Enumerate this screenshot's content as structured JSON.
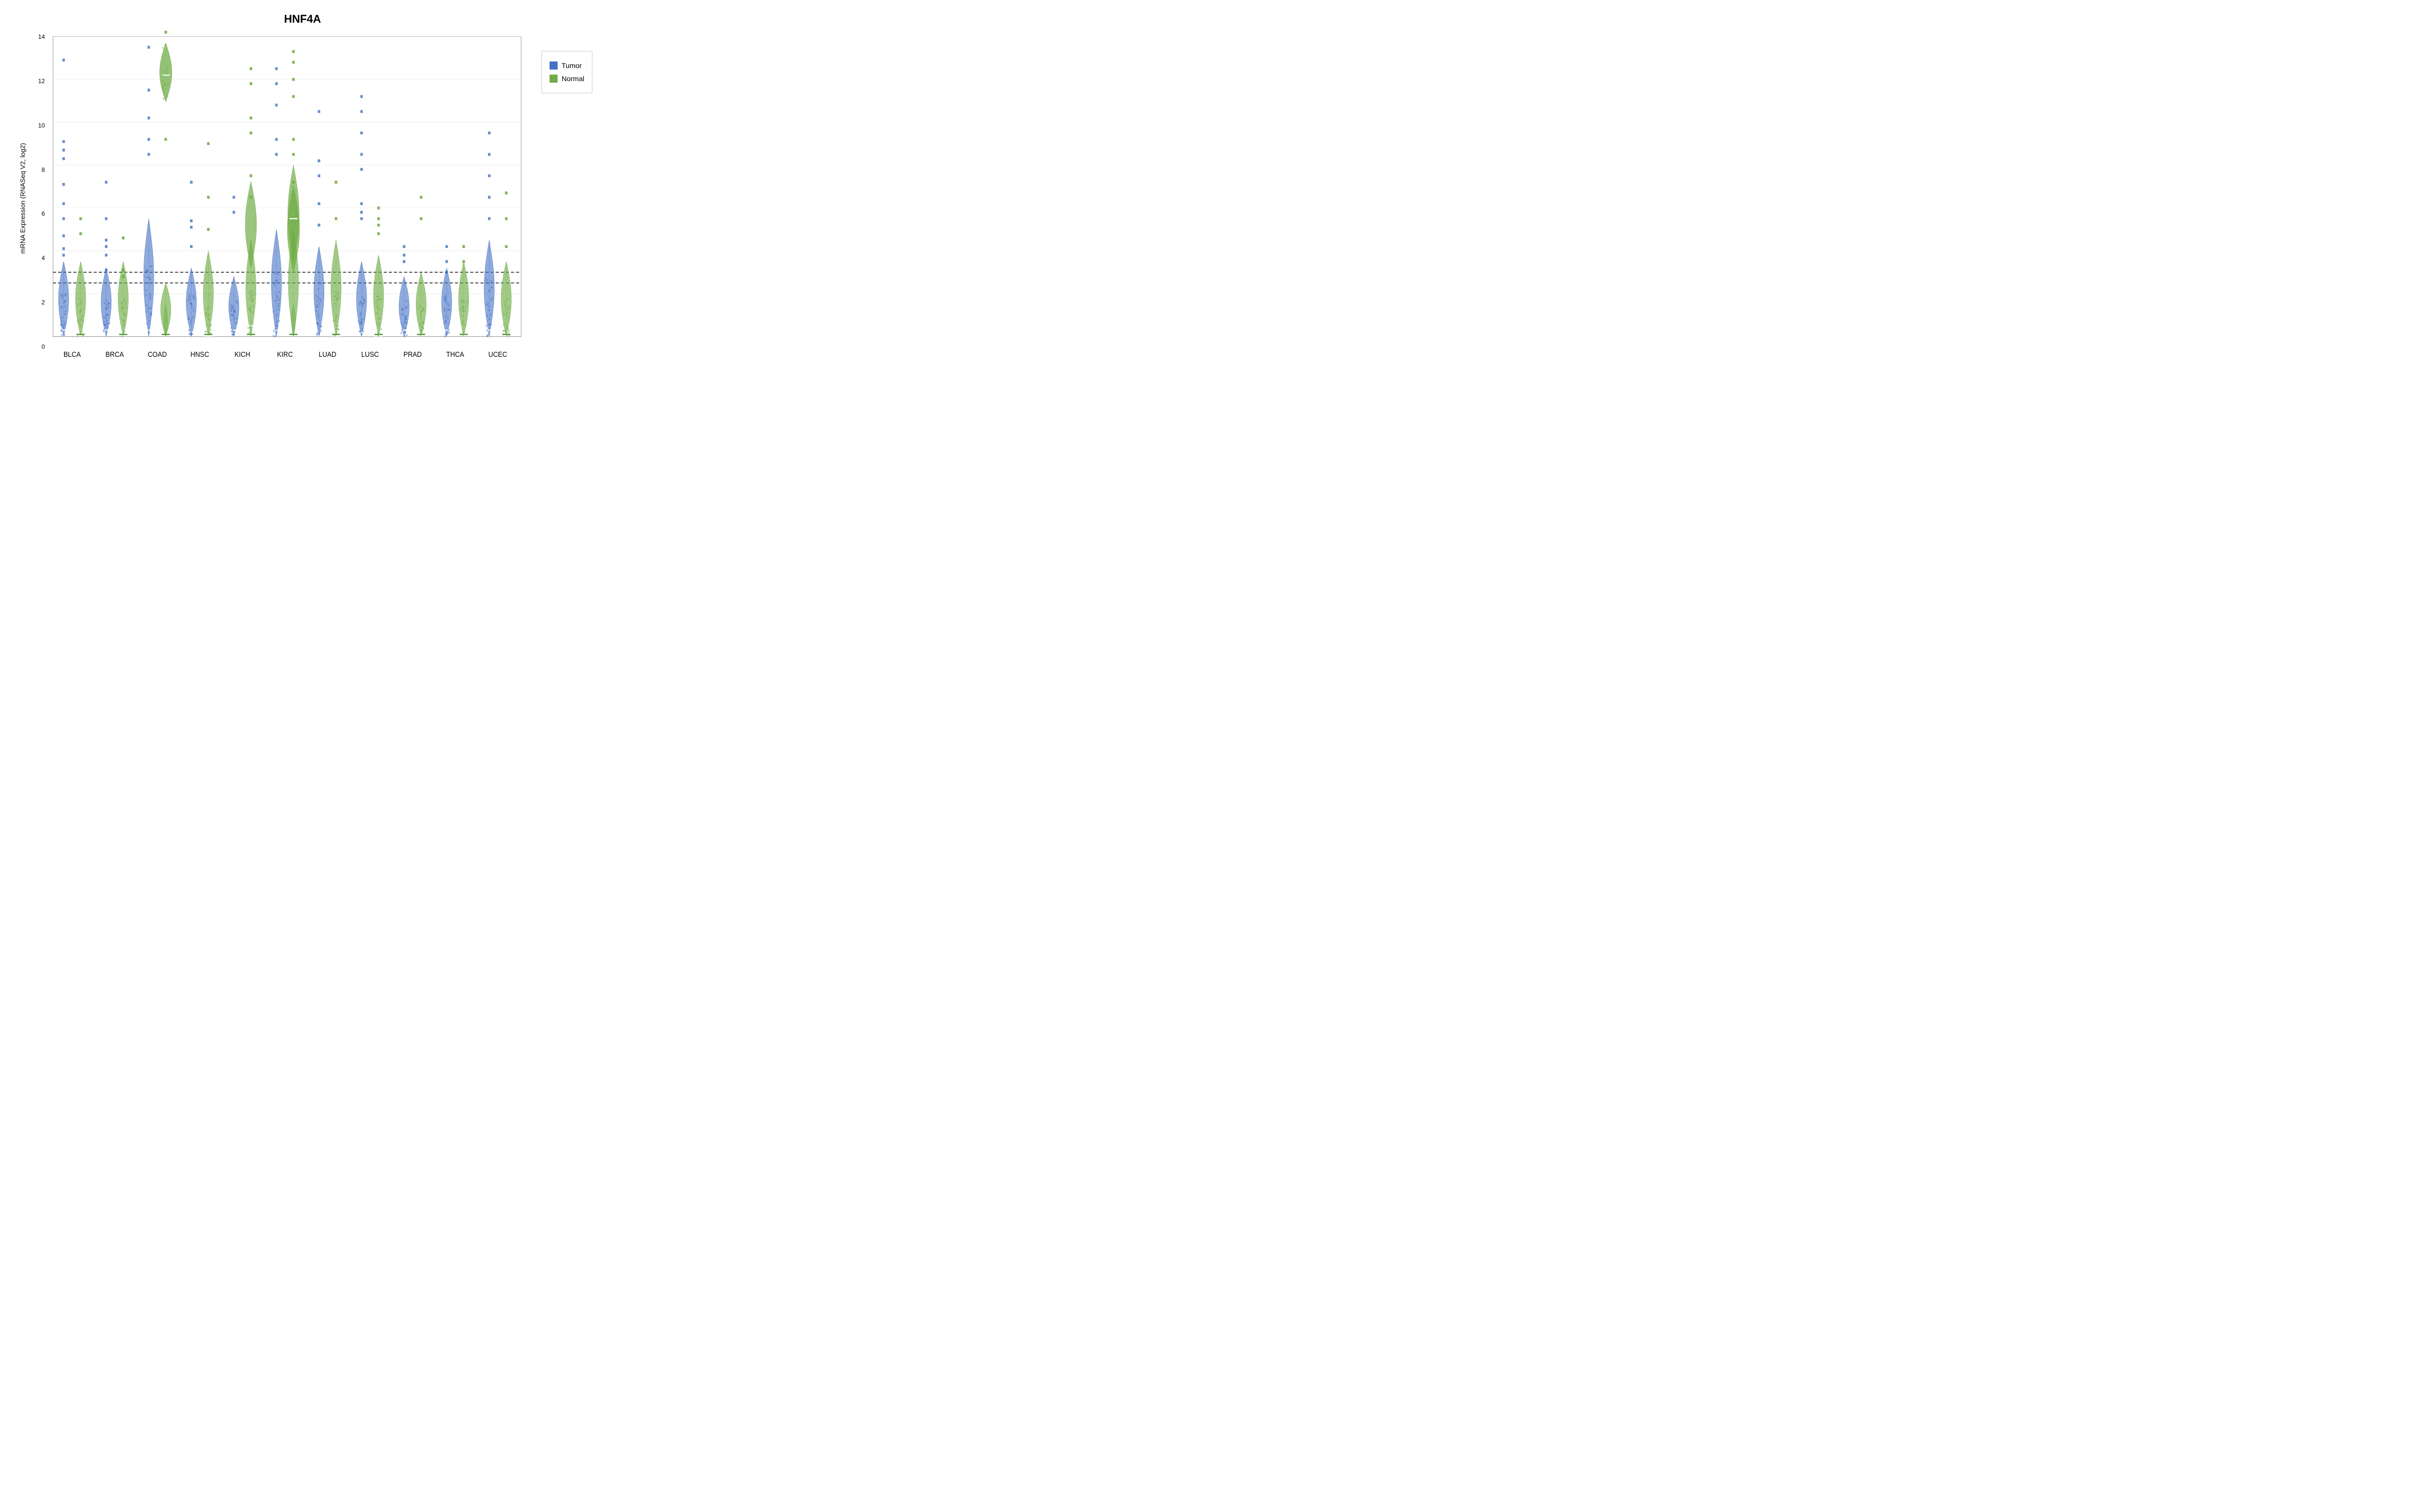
{
  "title": "HNF4A",
  "yAxisLabel": "mRNA Expression (RNASeq V2, log2)",
  "xAxisLabels": [
    "BLCA",
    "BRCA",
    "COAD",
    "HNSC",
    "KICH",
    "KIRC",
    "LUAD",
    "LUSC",
    "PRAD",
    "THCA",
    "UCEC"
  ],
  "yTicks": [
    "0",
    "2",
    "4",
    "6",
    "8",
    "10",
    "12",
    "14"
  ],
  "legend": [
    {
      "label": "Tumor",
      "color": "#4472C4"
    },
    {
      "label": "Normal",
      "color": "#70AD47"
    }
  ],
  "colors": {
    "tumor": "#4472C4",
    "normal": "#70AD47",
    "tumorLight": "#9DC3E6",
    "normalLight": "#A9D18E",
    "dottedLine": "#000000"
  },
  "dotted_lines": [
    2.5,
    3.0
  ],
  "violinData": [
    {
      "name": "BLCA",
      "tumorPeak": 0.3,
      "normalPeak": 0.4,
      "tumorSpread": 3.5,
      "normalSpread": 3.5,
      "tumorOutliers": [
        9.1,
        8.7,
        8.3,
        7.1,
        6.2,
        5.5,
        4.7,
        4.1,
        3.8,
        12.9
      ],
      "normalOutliers": [
        5.5,
        4.8
      ]
    },
    {
      "name": "BRCA",
      "tumorPeak": 0.3,
      "normalPeak": 0.5,
      "tumorSpread": 3.2,
      "normalSpread": 3.5,
      "tumorOutliers": [
        7.2,
        5.5,
        4.5,
        4.2,
        3.8,
        3.1
      ],
      "normalOutliers": [
        4.6,
        3.1,
        2.8
      ]
    },
    {
      "name": "COAD",
      "tumorPeak": 0.3,
      "normalPeak": 12.2,
      "tumorSpread": 5.5,
      "normalSpread": 2.5,
      "tumorOutliers": [
        8.5,
        9.2,
        10.2,
        11.5,
        13.5
      ],
      "normalOutliers": [
        9.2,
        14.2
      ]
    },
    {
      "name": "HNSC",
      "tumorPeak": 0.2,
      "normalPeak": 0.3,
      "tumorSpread": 3.2,
      "normalSpread": 4.0,
      "tumorOutliers": [
        7.2,
        5.4,
        5.1,
        4.2
      ],
      "normalOutliers": [
        9.0,
        6.5,
        5.0
      ]
    },
    {
      "name": "KICH",
      "tumorPeak": 0.3,
      "normalPeak": 5.0,
      "tumorSpread": 2.8,
      "normalSpread": 4.5,
      "tumorOutliers": [
        6.5,
        5.8
      ],
      "normalOutliers": [
        12.5,
        11.8,
        10.2,
        9.5,
        7.5,
        6.5
      ]
    },
    {
      "name": "KIRC",
      "tumorPeak": 0.3,
      "normalPeak": 5.5,
      "tumorSpread": 5.0,
      "normalSpread": 5.0,
      "tumorOutliers": [
        12.5,
        11.8,
        10.8,
        9.2,
        8.5
      ],
      "normalOutliers": [
        13.3,
        12.8,
        12.0,
        11.2,
        9.2,
        8.5,
        7.2
      ]
    },
    {
      "name": "LUAD",
      "tumorPeak": 0.2,
      "normalPeak": 0.3,
      "tumorSpread": 4.2,
      "normalSpread": 4.5,
      "tumorOutliers": [
        10.5,
        8.2,
        7.5,
        6.2,
        5.2
      ],
      "normalOutliers": [
        7.2,
        5.5
      ]
    },
    {
      "name": "LUSC",
      "tumorPeak": 0.2,
      "normalPeak": 0.3,
      "tumorSpread": 3.5,
      "normalSpread": 3.8,
      "tumorOutliers": [
        11.2,
        10.5,
        9.5,
        8.5,
        7.8,
        6.2,
        5.8,
        5.5
      ],
      "normalOutliers": [
        6.0,
        5.5,
        5.2,
        4.8
      ]
    },
    {
      "name": "PRAD",
      "tumorPeak": 0.3,
      "normalPeak": 0.5,
      "tumorSpread": 2.8,
      "normalSpread": 3.0,
      "tumorOutliers": [
        3.8,
        4.2,
        3.5
      ],
      "normalOutliers": [
        6.5,
        5.5
      ]
    },
    {
      "name": "THCA",
      "tumorPeak": 0.3,
      "normalPeak": 0.5,
      "tumorSpread": 3.2,
      "normalSpread": 3.5,
      "tumorOutliers": [
        4.2,
        3.5,
        3.0
      ],
      "normalOutliers": [
        4.2,
        3.5
      ]
    },
    {
      "name": "UCEC",
      "tumorPeak": 0.3,
      "normalPeak": 0.5,
      "tumorSpread": 4.5,
      "normalSpread": 3.5,
      "tumorOutliers": [
        9.5,
        8.5,
        7.5,
        6.5,
        5.5
      ],
      "normalOutliers": [
        6.7,
        5.5,
        4.2
      ]
    }
  ]
}
